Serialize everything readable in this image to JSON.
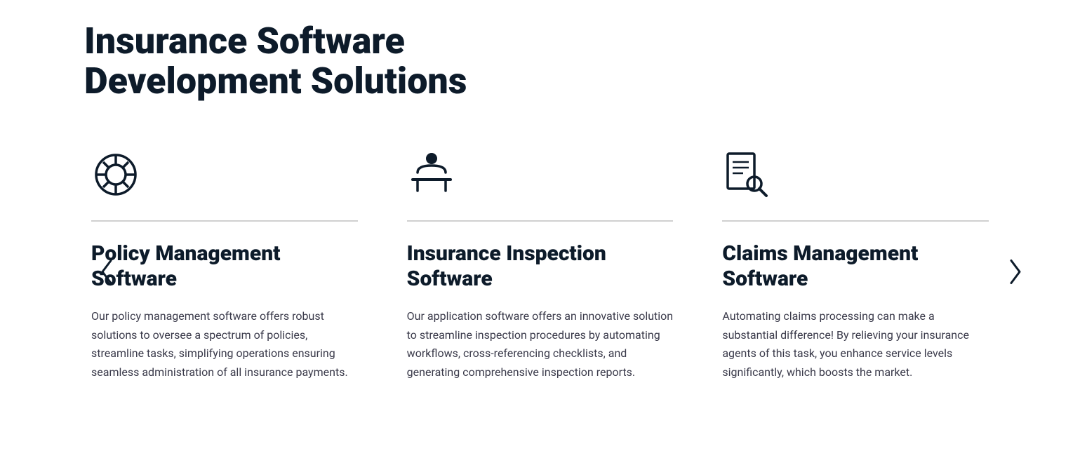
{
  "header": {
    "title_line1": "Insurance Software",
    "title_line2": "Development Solutions"
  },
  "nav": {
    "left_arrow": "❮",
    "right_arrow": "❯"
  },
  "cards": [
    {
      "id": "policy-management",
      "icon": "shield-circle",
      "title": "Policy Management Software",
      "description": "Our policy management software offers robust solutions to oversee a spectrum of policies, streamline tasks, simplifying operations ensuring seamless administration of all insurance payments."
    },
    {
      "id": "insurance-inspection",
      "icon": "person-table",
      "title": "Insurance Inspection Software",
      "description": "Our application software offers an innovative solution to streamline inspection procedures by automating workflows, cross-referencing checklists, and generating comprehensive inspection reports."
    },
    {
      "id": "claims-management",
      "icon": "doc-search",
      "title": "Claims Management Software",
      "description": "Automating claims processing can make a substantial difference! By relieving your insurance agents of this task, you enhance service levels significantly, which boosts the market."
    }
  ]
}
